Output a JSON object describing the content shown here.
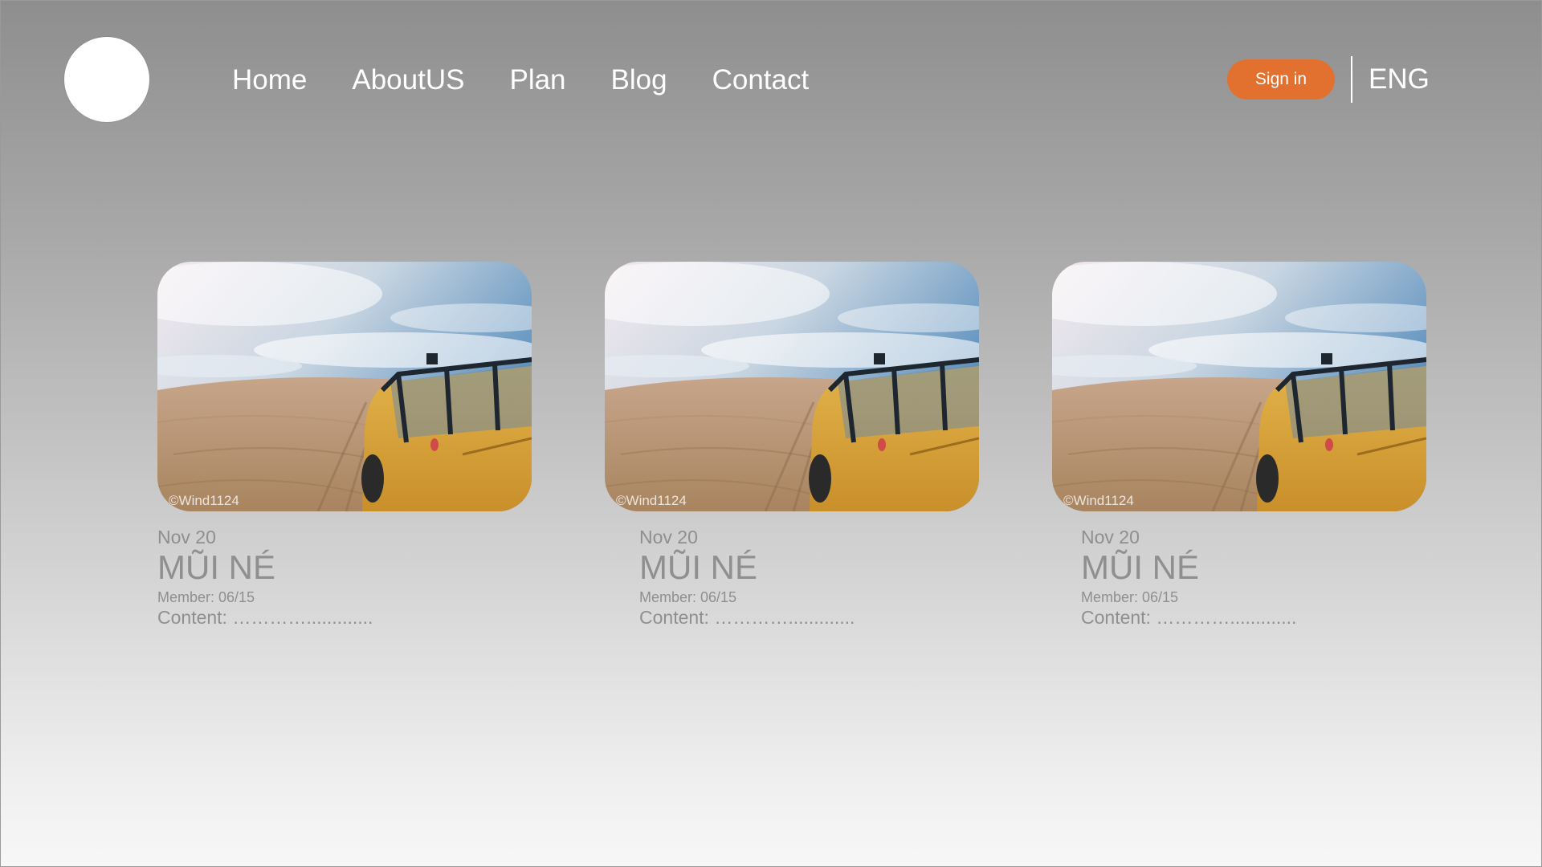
{
  "nav": {
    "items": [
      {
        "label": "Home"
      },
      {
        "label": "AboutUS"
      },
      {
        "label": "Plan"
      },
      {
        "label": "Blog"
      },
      {
        "label": "Contact"
      }
    ],
    "signin_label": "Sign in",
    "language": "ENG",
    "accent_color": "#e2702f"
  },
  "cards": [
    {
      "date": "Nov 20",
      "title": "MŨI NÉ",
      "member": "Member: 06/15",
      "content": "Content: ………….............",
      "watermark": "©Wind1124"
    },
    {
      "date": "Nov 20",
      "title": "MŨI NÉ",
      "member": "Member: 06/15",
      "content": "Content: ………….............",
      "watermark": "©Wind1124"
    },
    {
      "date": "Nov 20",
      "title": "MŨI NÉ",
      "member": "Member: 06/15",
      "content": "Content: ………….............",
      "watermark": "©Wind1124"
    }
  ]
}
